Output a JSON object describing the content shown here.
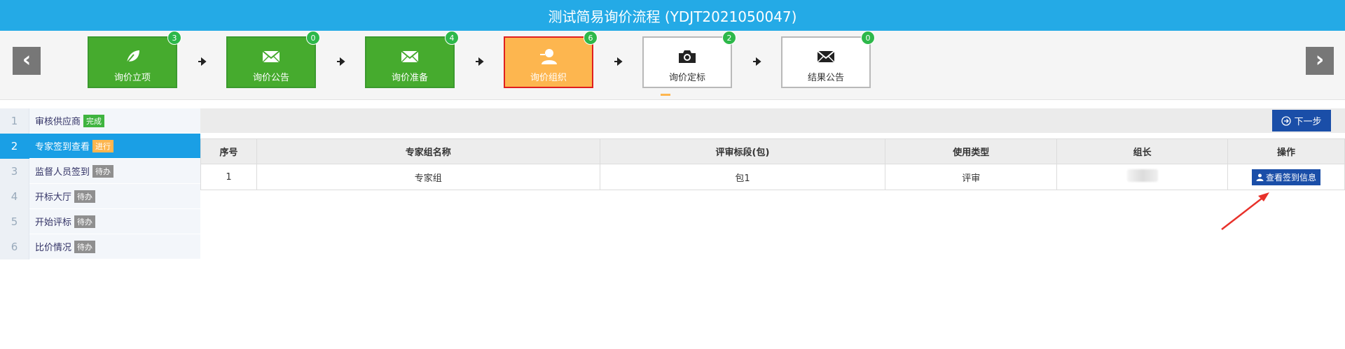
{
  "window": {
    "title": "测试简易询价流程 (YDJT2021050047)"
  },
  "colors": {
    "header": "#24aae6",
    "step_done": "#46ab2e",
    "step_active": "#fdb64f",
    "badge": "#2db84a",
    "sidebar_active": "#1a9fe5",
    "primary_button": "#1a4ea8",
    "annotation_arrow": "#e8312a"
  },
  "nav": {
    "prev_icon": "‹",
    "next_icon": "›"
  },
  "steps": [
    {
      "label": "询价立项",
      "badge": "3",
      "status": "done",
      "icon": "leaf-icon"
    },
    {
      "label": "询价公告",
      "badge": "0",
      "status": "done",
      "icon": "envelope-icon"
    },
    {
      "label": "询价准备",
      "badge": "4",
      "status": "done",
      "icon": "envelope-icon"
    },
    {
      "label": "询价组织",
      "badge": "6",
      "status": "active",
      "icon": "user-icon"
    },
    {
      "label": "询价定标",
      "badge": "2",
      "status": "pending",
      "icon": "camera-icon"
    },
    {
      "label": "结果公告",
      "badge": "0",
      "status": "pending",
      "icon": "envelope-icon"
    }
  ],
  "sidebar": {
    "items": [
      {
        "num": "1",
        "label": "审核供应商",
        "tag": "完成",
        "state": "done"
      },
      {
        "num": "2",
        "label": "专家签到查看",
        "tag": "进行",
        "state": "doing"
      },
      {
        "num": "3",
        "label": "监督人员签到",
        "tag": "待办",
        "state": "todo"
      },
      {
        "num": "4",
        "label": "开标大厅",
        "tag": "待办",
        "state": "todo"
      },
      {
        "num": "5",
        "label": "开始评标",
        "tag": "待办",
        "state": "todo"
      },
      {
        "num": "6",
        "label": "比价情况",
        "tag": "待办",
        "state": "todo"
      }
    ]
  },
  "toolbar": {
    "next_label": "下一步"
  },
  "table": {
    "headers": [
      "序号",
      "专家组名称",
      "评审标段(包)",
      "使用类型",
      "组长",
      "操作"
    ],
    "rows": [
      {
        "index": "1",
        "group_name": "专家组",
        "segment": "包1",
        "usage_type": "评审",
        "action_label": "查看签到信息"
      }
    ]
  }
}
